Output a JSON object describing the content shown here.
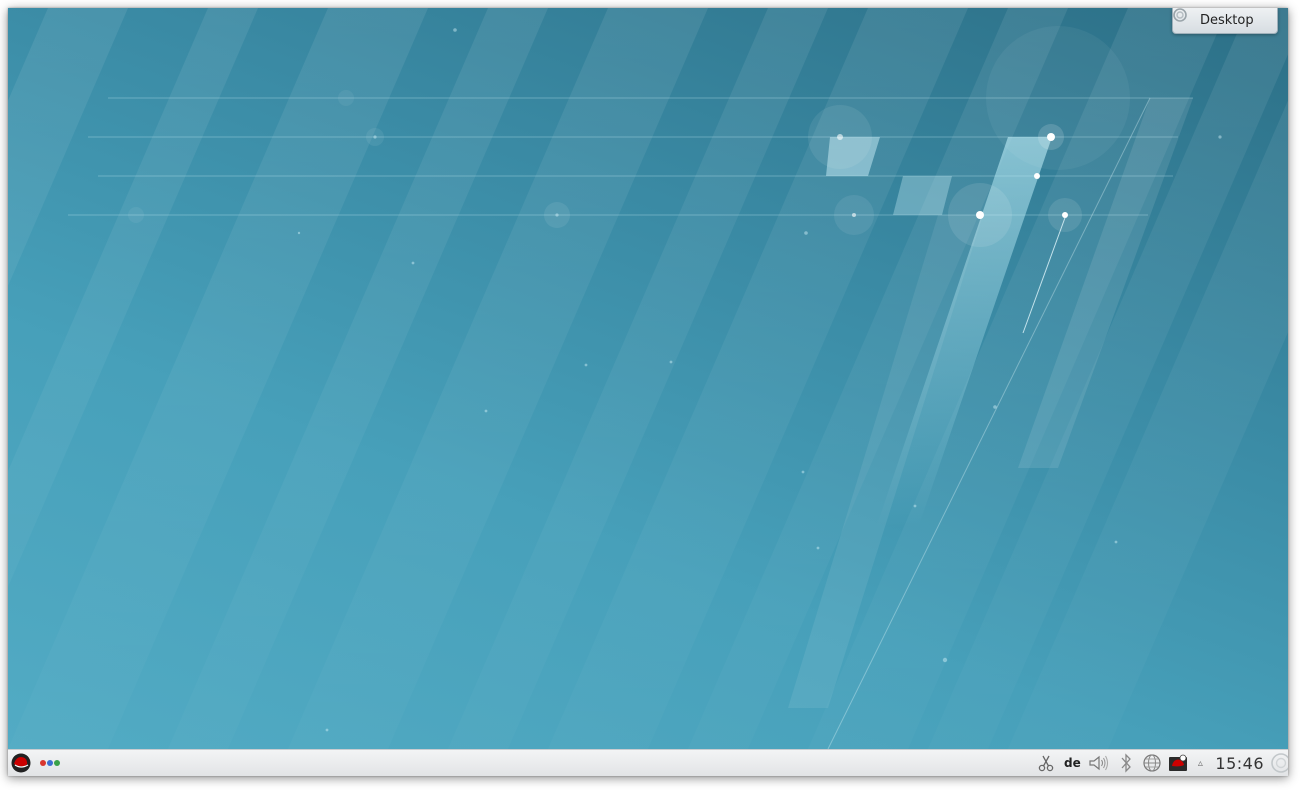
{
  "desktop_toolbox": {
    "label": "Desktop",
    "icon": "plasma-cashew-icon"
  },
  "panel": {
    "launcher_icon": "redhat-application-launcher-icon",
    "pager_colors": [
      "#d9362f",
      "#3d6fd0",
      "#3aa14a"
    ],
    "system_tray": {
      "clipboard_icon": "scissors-icon",
      "keyboard_layout": "de",
      "volume_icon": "speaker-icon",
      "bluetooth_icon": "bluetooth-icon",
      "network_icon": "network-globe-icon",
      "updates_icon": "redhat-update-icon",
      "expand_icon": "chevron-up-icon"
    },
    "clock": "15:46",
    "panel_toolbox_icon": "plasma-cashew-icon"
  },
  "colors": {
    "wallpaper_dark": "#2c6f86",
    "wallpaper_light": "#52abc4",
    "panel": "#eceeef",
    "redhat_red": "#cc0000"
  }
}
